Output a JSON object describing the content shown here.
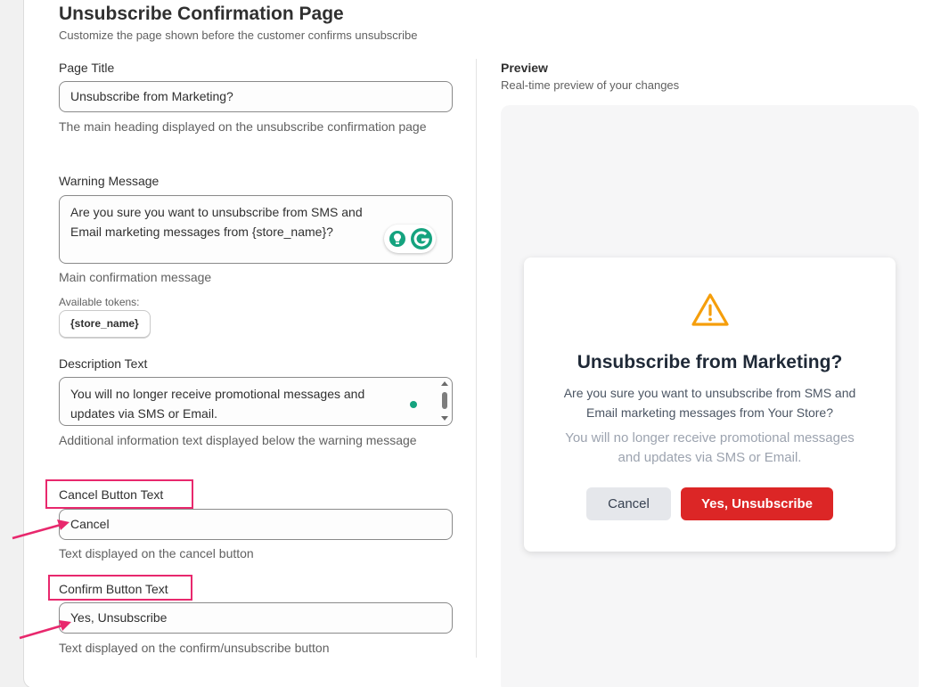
{
  "header": {
    "title": "Unsubscribe Confirmation Page",
    "subtitle": "Customize the page shown before the customer confirms unsubscribe"
  },
  "form": {
    "page_title": {
      "label": "Page Title",
      "value": "Unsubscribe from Marketing?",
      "help": "The main heading displayed on the unsubscribe confirmation page"
    },
    "warning_message": {
      "label": "Warning Message",
      "value": "Are you sure you want to unsubscribe from SMS and Email marketing messages from {store_name}?",
      "help": "Main confirmation message",
      "tokens_label": "Available tokens:",
      "tokens": [
        "{store_name}"
      ]
    },
    "description_text": {
      "label": "Description Text",
      "value": "You will no longer receive promotional messages and updates via SMS or Email.",
      "help": "Additional information text displayed below the warning message"
    },
    "cancel_button_text": {
      "label": "Cancel Button Text",
      "value": "Cancel",
      "help": "Text displayed on the cancel button"
    },
    "confirm_button_text": {
      "label": "Confirm Button Text",
      "value": "Yes, Unsubscribe",
      "help": "Text displayed on the confirm/unsubscribe button"
    }
  },
  "preview": {
    "title": "Preview",
    "subtitle": "Real-time preview of your changes",
    "modal": {
      "icon": "warning-triangle-icon",
      "title": "Unsubscribe from Marketing?",
      "warning": "Are you sure you want to unsubscribe from SMS and Email marketing messages from Your Store?",
      "description": "You will no longer receive promotional messages and updates via SMS or Email.",
      "cancel_label": "Cancel",
      "confirm_label": "Yes, Unsubscribe"
    }
  },
  "colors": {
    "annotation": "#e8286d",
    "confirm_button": "#dc2626",
    "cancel_button": "#e5e7eb",
    "warning_icon": "#f59e0b",
    "grammarly": "#15a37f"
  }
}
